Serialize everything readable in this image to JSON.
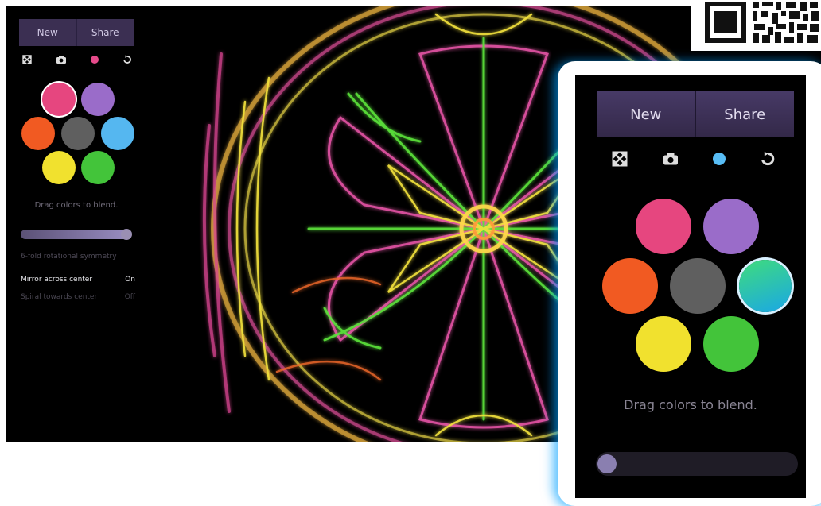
{
  "panel": {
    "new_label": "New",
    "share_label": "Share",
    "hint": "Drag colors to blend.",
    "symmetry_label": "6-fold rotational symmetry",
    "mirror_label": "Mirror across center",
    "mirror_value": "On",
    "spiral_label": "Spiral towards center",
    "spiral_value": "Off"
  },
  "zoom_panel": {
    "new_label": "New",
    "share_label": "Share",
    "hint": "Drag colors to blend."
  },
  "icons": [
    "fullscreen-icon",
    "camera-icon",
    "color-dot-icon",
    "undo-icon"
  ],
  "colors": {
    "pink": "#e6467f",
    "purple": "#9a6cc9",
    "orange": "#f15a22",
    "gray": "#5f5f5f",
    "blue": "#55b7f0",
    "yellow": "#f1e12e",
    "green": "#43c43a",
    "selected_small": "#e64a8a",
    "selected_large": "#58bdf5"
  }
}
